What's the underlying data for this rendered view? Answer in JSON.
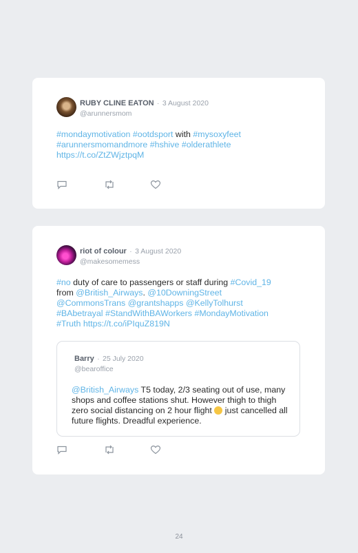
{
  "tweets": [
    {
      "name": "RUBY CLINE EATON",
      "date": "3 August 2020",
      "handle": "@arunnersmom",
      "body": [
        {
          "t": "#mondaymotivation",
          "tag": true
        },
        {
          "t": " ",
          "tag": false
        },
        {
          "t": "#ootdsport",
          "tag": true
        },
        {
          "t": " with ",
          "tag": false
        },
        {
          "t": "#mysoxyfeet",
          "tag": true
        },
        {
          "t": " ",
          "tag": false
        },
        {
          "t": "#arunnersmomandmore",
          "tag": true
        },
        {
          "t": " ",
          "tag": false
        },
        {
          "t": "#hshive",
          "tag": true
        },
        {
          "t": " ",
          "tag": false
        },
        {
          "t": "#olderathlete",
          "tag": true
        },
        {
          "t": " ",
          "tag": false
        },
        {
          "t": "https://t.co/ZtZWjztpqM",
          "tag": true
        }
      ]
    },
    {
      "name": "riot of colour",
      "date": "3 August 2020",
      "handle": "@makesomemess",
      "body": [
        {
          "t": "#no",
          "tag": true
        },
        {
          "t": " duty of care to passengers or staff during ",
          "tag": false
        },
        {
          "t": "#Covid_19",
          "tag": true
        },
        {
          "t": " from ",
          "tag": false
        },
        {
          "t": "@British_Airways",
          "tag": true
        },
        {
          "t": ". ",
          "tag": false
        },
        {
          "t": "@10DowningStreet",
          "tag": true
        },
        {
          "t": " ",
          "tag": false
        },
        {
          "t": "@CommonsTrans",
          "tag": true
        },
        {
          "t": " ",
          "tag": false
        },
        {
          "t": "@grantshapps",
          "tag": true
        },
        {
          "t": " ",
          "tag": false
        },
        {
          "t": "@KellyTolhurst",
          "tag": true
        },
        {
          "t": " ",
          "tag": false
        },
        {
          "t": "#BAbetrayal",
          "tag": true
        },
        {
          "t": " ",
          "tag": false
        },
        {
          "t": "#StandWithBAWorkers",
          "tag": true
        },
        {
          "t": " ",
          "tag": false
        },
        {
          "t": "#MondayMotivation",
          "tag": true
        },
        {
          "t": " ",
          "tag": false
        },
        {
          "t": "#Truth",
          "tag": true
        },
        {
          "t": " ",
          "tag": false
        },
        {
          "t": "https://t.co/iPIquZ819N",
          "tag": true
        }
      ],
      "quote": {
        "name": "Barry",
        "date": "25 July 2020",
        "handle": "@bearoffice",
        "body": [
          {
            "t": "@British_Airways",
            "tag": true
          },
          {
            "t": " T5 today, 2/3 seating out of use, many shops and coffee stations shut. However thigh to thigh zero social distancing on 2 hour flight ",
            "tag": false
          },
          {
            "emoji": "flushed-face-icon"
          },
          {
            "t": " just cancelled all future flights. Dreadful experience.",
            "tag": false
          }
        ]
      }
    }
  ],
  "date_separator": "·",
  "page_number": "24",
  "colors": {
    "link": "#5fb4e6",
    "background": "#ebedf0",
    "card": "#ffffff"
  }
}
